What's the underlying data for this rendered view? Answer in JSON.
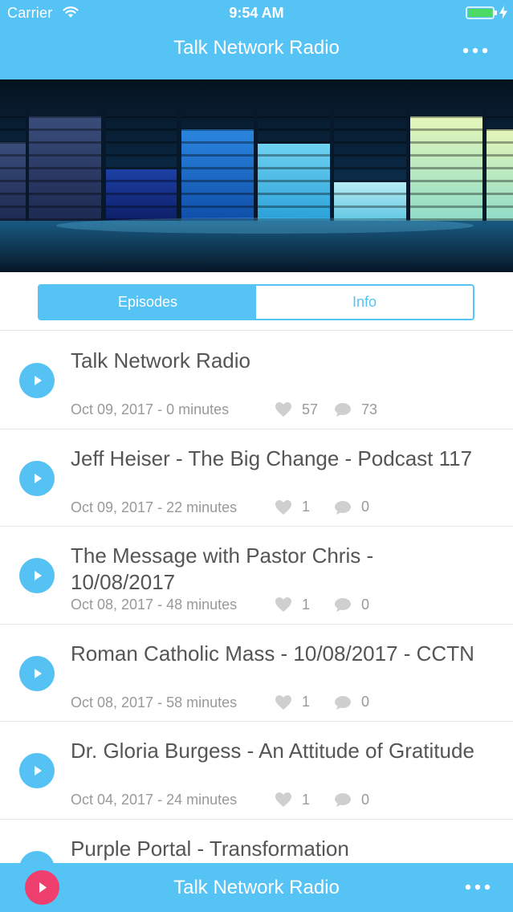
{
  "status_bar": {
    "carrier": "Carrier",
    "time": "9:54 AM",
    "wifi_icon": "wifi-icon",
    "battery_icon": "battery-full-icon",
    "charging_icon": "charging-bolt-icon"
  },
  "nav": {
    "title": "Talk Network Radio",
    "more_icon": "more-dots-icon"
  },
  "hero": {
    "image": "audio-equalizer-artwork"
  },
  "tabs": [
    {
      "label": "Episodes",
      "selected": true
    },
    {
      "label": "Info",
      "selected": false
    }
  ],
  "episodes": [
    {
      "title": "Talk Network Radio",
      "meta": "Oct 09, 2017 - 0 minutes",
      "likes": "57",
      "comments": "73"
    },
    {
      "title": "Jeff Heiser - The Big Change - Podcast 117",
      "meta": "Oct 09, 2017 - 22 minutes",
      "likes": "1",
      "comments": "0"
    },
    {
      "title": "The Message with Pastor Chris - 10/08/2017",
      "meta": "Oct 08, 2017 - 48 minutes",
      "likes": "1",
      "comments": "0"
    },
    {
      "title": "Roman Catholic Mass - 10/08/2017 - CCTN",
      "meta": "Oct 08, 2017 - 58 minutes",
      "likes": "1",
      "comments": "0"
    },
    {
      "title": "Dr. Gloria Burgess - An Attitude of Gratitude",
      "meta": "Oct 04, 2017 - 24 minutes",
      "likes": "1",
      "comments": "0"
    },
    {
      "title": "Purple Portal - Transformation",
      "meta": "",
      "likes": "",
      "comments": ""
    }
  ],
  "player": {
    "title": "Talk Network Radio",
    "play_icon": "play-icon",
    "more_icon": "more-dots-icon"
  },
  "colors": {
    "accent": "#55c3f4",
    "player_play": "#ee3f6e",
    "text": "#555555",
    "meta_text": "#999999"
  }
}
